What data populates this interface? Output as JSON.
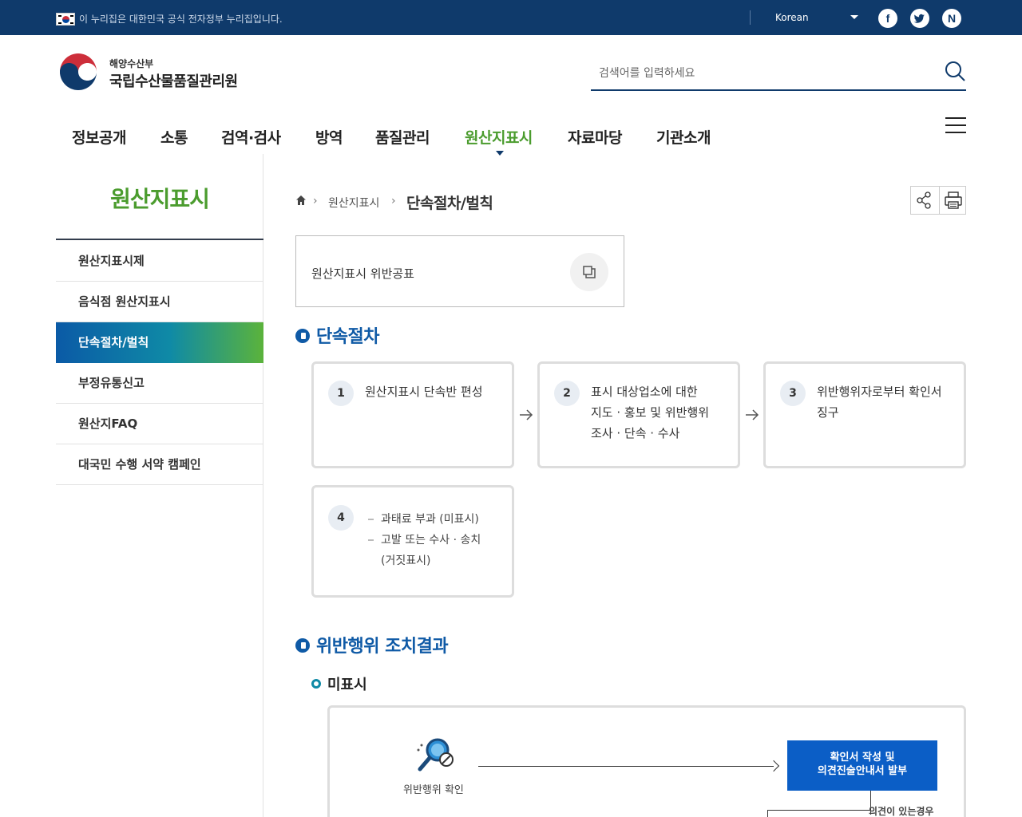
{
  "top_bar": {
    "notice": "이 누리집은 대한민국 공식 전자정부 누리집입니다.",
    "language": "Korean",
    "social": [
      "f",
      "t",
      "N"
    ]
  },
  "header": {
    "org_sub": "해양수산부",
    "org_main": "국립수산물품질관리원",
    "search_placeholder": "검색어를 입력하세요"
  },
  "gnb": {
    "items": [
      "정보공개",
      "소통",
      "검역·검사",
      "방역",
      "품질관리",
      "원산지표시",
      "자료마당",
      "기관소개"
    ],
    "active_index": 5
  },
  "sidebar": {
    "title": "원산지표시",
    "items": [
      "원산지표시제",
      "음식점 원산지표시",
      "단속절차/벌칙",
      "부정유통신고",
      "원산지FAQ",
      "대국민 수행 서약 캠페인"
    ],
    "active_index": 2
  },
  "breadcrumb": {
    "level1": "원산지표시",
    "current": "단속절차/벌칙"
  },
  "link_box": {
    "label": "원산지표시 위반공표"
  },
  "section1": {
    "title": "단속절차",
    "steps": [
      {
        "num": "1",
        "lines": [
          "원산지표시 단속반 편성"
        ]
      },
      {
        "num": "2",
        "lines": [
          "표시 대상업소에 대한",
          "지도 · 홍보 및 위반행위",
          "조사 · 단속 · 수사"
        ]
      },
      {
        "num": "3",
        "lines": [
          "위반행위자로부터 확인서",
          "징구"
        ]
      },
      {
        "num": "4",
        "lines": [
          "과태료 부과 (미표시)",
          "고발 또는 수사 · 송치",
          "(거짓표시)"
        ]
      }
    ]
  },
  "section2": {
    "title": "위반행위 조치결과",
    "subtitle": "미표시",
    "flow": {
      "start_label": "위반행위 확인",
      "box_line1": "확인서 작성 및",
      "box_line2": "의견진술안내서 발부",
      "branch_label": "의견이 있는경우"
    }
  },
  "colors": {
    "top_bar": "#0f3a6b",
    "accent_green": "#4b9c2e",
    "accent_blue": "#0f5aa6",
    "flow_box": "#0b5ec6"
  },
  "icons": [
    "korean-flag-icon",
    "facebook-icon",
    "twitter-icon",
    "naver-icon",
    "search-icon",
    "menu-icon",
    "home-icon",
    "share-icon",
    "print-icon",
    "copy-icon",
    "arrow-right-icon",
    "magnifier-icon"
  ]
}
